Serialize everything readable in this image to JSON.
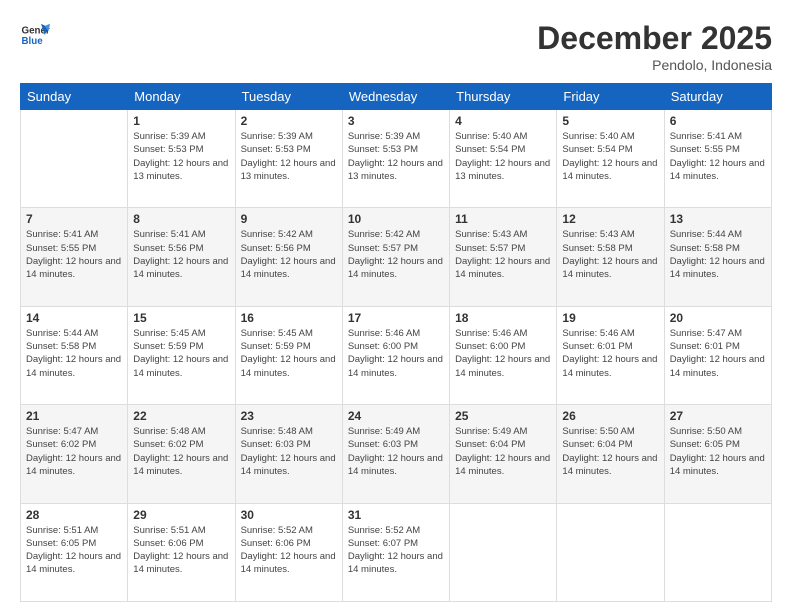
{
  "logo": {
    "line1": "General",
    "line2": "Blue"
  },
  "title": "December 2025",
  "subtitle": "Pendolo, Indonesia",
  "weekdays": [
    "Sunday",
    "Monday",
    "Tuesday",
    "Wednesday",
    "Thursday",
    "Friday",
    "Saturday"
  ],
  "weeks": [
    [
      {
        "day": "",
        "info": ""
      },
      {
        "day": "1",
        "info": "Sunrise: 5:39 AM\nSunset: 5:53 PM\nDaylight: 12 hours\nand 13 minutes."
      },
      {
        "day": "2",
        "info": "Sunrise: 5:39 AM\nSunset: 5:53 PM\nDaylight: 12 hours\nand 13 minutes."
      },
      {
        "day": "3",
        "info": "Sunrise: 5:39 AM\nSunset: 5:53 PM\nDaylight: 12 hours\nand 13 minutes."
      },
      {
        "day": "4",
        "info": "Sunrise: 5:40 AM\nSunset: 5:54 PM\nDaylight: 12 hours\nand 13 minutes."
      },
      {
        "day": "5",
        "info": "Sunrise: 5:40 AM\nSunset: 5:54 PM\nDaylight: 12 hours\nand 14 minutes."
      },
      {
        "day": "6",
        "info": "Sunrise: 5:41 AM\nSunset: 5:55 PM\nDaylight: 12 hours\nand 14 minutes."
      }
    ],
    [
      {
        "day": "7",
        "info": "Sunrise: 5:41 AM\nSunset: 5:55 PM\nDaylight: 12 hours\nand 14 minutes."
      },
      {
        "day": "8",
        "info": "Sunrise: 5:41 AM\nSunset: 5:56 PM\nDaylight: 12 hours\nand 14 minutes."
      },
      {
        "day": "9",
        "info": "Sunrise: 5:42 AM\nSunset: 5:56 PM\nDaylight: 12 hours\nand 14 minutes."
      },
      {
        "day": "10",
        "info": "Sunrise: 5:42 AM\nSunset: 5:57 PM\nDaylight: 12 hours\nand 14 minutes."
      },
      {
        "day": "11",
        "info": "Sunrise: 5:43 AM\nSunset: 5:57 PM\nDaylight: 12 hours\nand 14 minutes."
      },
      {
        "day": "12",
        "info": "Sunrise: 5:43 AM\nSunset: 5:58 PM\nDaylight: 12 hours\nand 14 minutes."
      },
      {
        "day": "13",
        "info": "Sunrise: 5:44 AM\nSunset: 5:58 PM\nDaylight: 12 hours\nand 14 minutes."
      }
    ],
    [
      {
        "day": "14",
        "info": "Sunrise: 5:44 AM\nSunset: 5:58 PM\nDaylight: 12 hours\nand 14 minutes."
      },
      {
        "day": "15",
        "info": "Sunrise: 5:45 AM\nSunset: 5:59 PM\nDaylight: 12 hours\nand 14 minutes."
      },
      {
        "day": "16",
        "info": "Sunrise: 5:45 AM\nSunset: 5:59 PM\nDaylight: 12 hours\nand 14 minutes."
      },
      {
        "day": "17",
        "info": "Sunrise: 5:46 AM\nSunset: 6:00 PM\nDaylight: 12 hours\nand 14 minutes."
      },
      {
        "day": "18",
        "info": "Sunrise: 5:46 AM\nSunset: 6:00 PM\nDaylight: 12 hours\nand 14 minutes."
      },
      {
        "day": "19",
        "info": "Sunrise: 5:46 AM\nSunset: 6:01 PM\nDaylight: 12 hours\nand 14 minutes."
      },
      {
        "day": "20",
        "info": "Sunrise: 5:47 AM\nSunset: 6:01 PM\nDaylight: 12 hours\nand 14 minutes."
      }
    ],
    [
      {
        "day": "21",
        "info": "Sunrise: 5:47 AM\nSunset: 6:02 PM\nDaylight: 12 hours\nand 14 minutes."
      },
      {
        "day": "22",
        "info": "Sunrise: 5:48 AM\nSunset: 6:02 PM\nDaylight: 12 hours\nand 14 minutes."
      },
      {
        "day": "23",
        "info": "Sunrise: 5:48 AM\nSunset: 6:03 PM\nDaylight: 12 hours\nand 14 minutes."
      },
      {
        "day": "24",
        "info": "Sunrise: 5:49 AM\nSunset: 6:03 PM\nDaylight: 12 hours\nand 14 minutes."
      },
      {
        "day": "25",
        "info": "Sunrise: 5:49 AM\nSunset: 6:04 PM\nDaylight: 12 hours\nand 14 minutes."
      },
      {
        "day": "26",
        "info": "Sunrise: 5:50 AM\nSunset: 6:04 PM\nDaylight: 12 hours\nand 14 minutes."
      },
      {
        "day": "27",
        "info": "Sunrise: 5:50 AM\nSunset: 6:05 PM\nDaylight: 12 hours\nand 14 minutes."
      }
    ],
    [
      {
        "day": "28",
        "info": "Sunrise: 5:51 AM\nSunset: 6:05 PM\nDaylight: 12 hours\nand 14 minutes."
      },
      {
        "day": "29",
        "info": "Sunrise: 5:51 AM\nSunset: 6:06 PM\nDaylight: 12 hours\nand 14 minutes."
      },
      {
        "day": "30",
        "info": "Sunrise: 5:52 AM\nSunset: 6:06 PM\nDaylight: 12 hours\nand 14 minutes."
      },
      {
        "day": "31",
        "info": "Sunrise: 5:52 AM\nSunset: 6:07 PM\nDaylight: 12 hours\nand 14 minutes."
      },
      {
        "day": "",
        "info": ""
      },
      {
        "day": "",
        "info": ""
      },
      {
        "day": "",
        "info": ""
      }
    ]
  ]
}
